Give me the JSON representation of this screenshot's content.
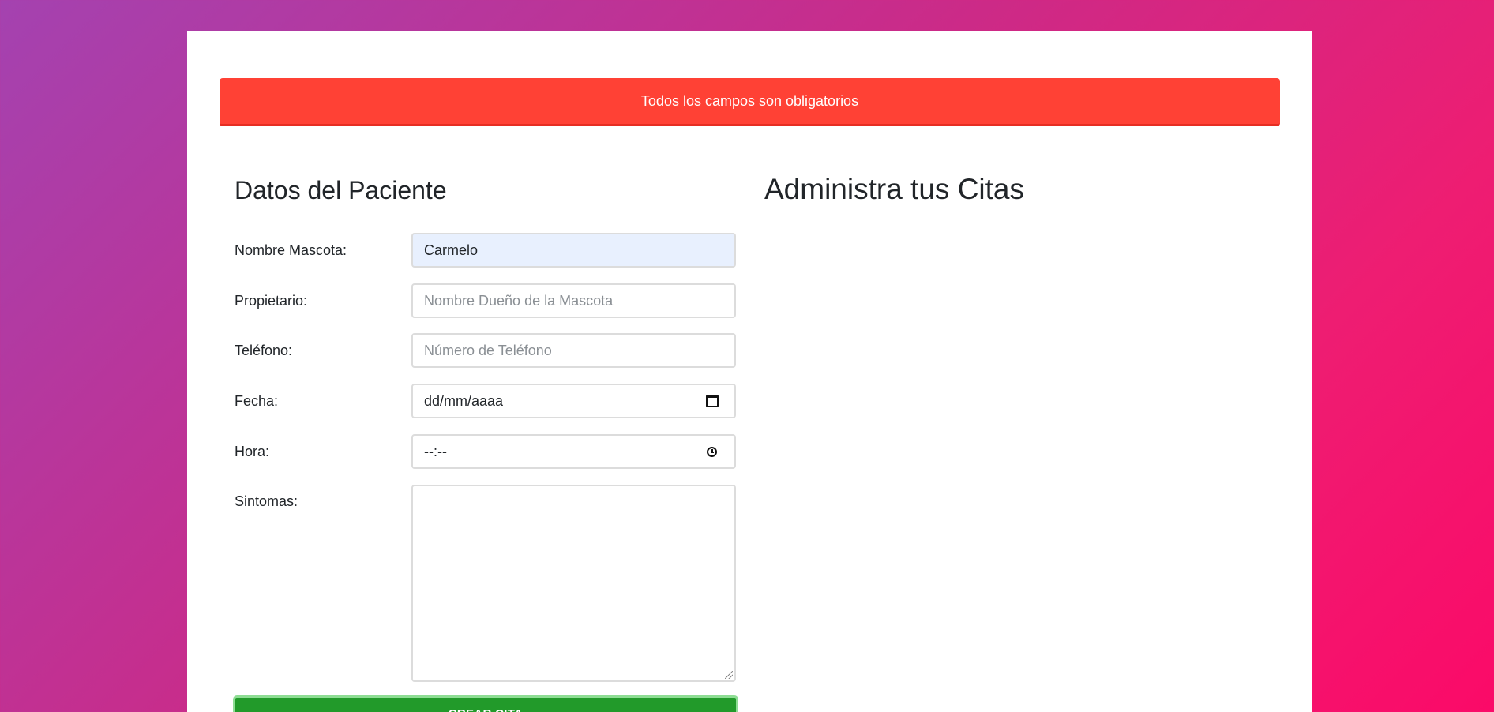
{
  "alert": {
    "message": "Todos los campos son obligatorios",
    "color": "#ff4135"
  },
  "form": {
    "heading": "Datos del Paciente",
    "fields": [
      {
        "label": "Nombre Mascota:",
        "value": "Carmelo",
        "placeholder": ""
      },
      {
        "label": "Propietario:",
        "value": "",
        "placeholder": "Nombre Dueño de la Mascota"
      },
      {
        "label": "Teléfono:",
        "value": "",
        "placeholder": "Número de Teléfono"
      },
      {
        "label": "Fecha:",
        "value": "dd/mm/aaaa",
        "icon": "calendar-icon"
      },
      {
        "label": "Hora:",
        "value": "--:--",
        "icon": "clock-icon"
      },
      {
        "label": "Sintomas:",
        "value": ""
      }
    ],
    "submit_label": "CREAR CITA",
    "submit_color": "#229a2a"
  },
  "appointments": {
    "heading": "Administra tus Citas"
  }
}
